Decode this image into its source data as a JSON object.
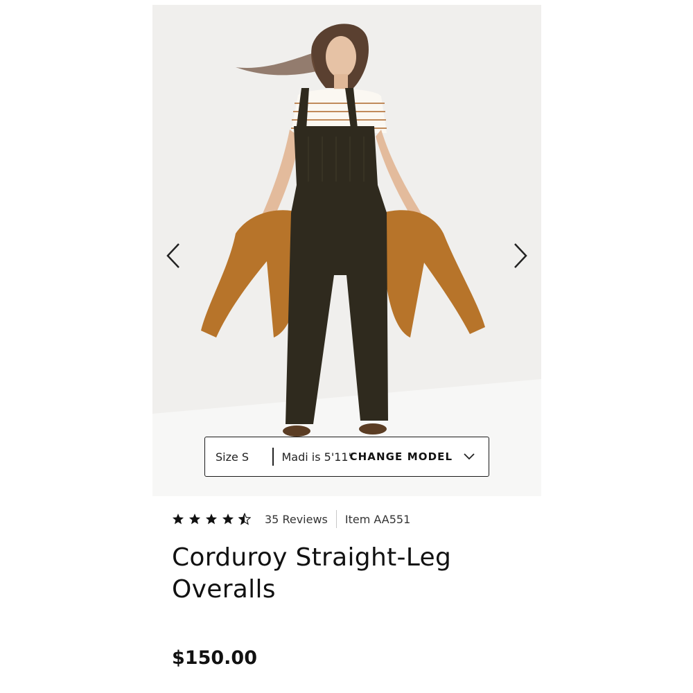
{
  "product": {
    "title": "Corduroy Straight-Leg Overalls",
    "price": "$150.00",
    "rating": 4.5,
    "rating_max": 5,
    "reviews_label": "35 Reviews",
    "item_number": "Item AA551"
  },
  "gallery": {
    "prev_icon": "chevron-left-icon",
    "next_icon": "chevron-right-icon"
  },
  "model_info": {
    "size": "Size S",
    "height": "Madi is 5'11\"",
    "change_label": "CHANGE MODEL",
    "change_icon": "chevron-down-icon"
  },
  "colors": {
    "overalls": "#2f2a1e",
    "sweater": "#b7742a",
    "backdrop": "#f1f0ee",
    "text": "#111111"
  }
}
